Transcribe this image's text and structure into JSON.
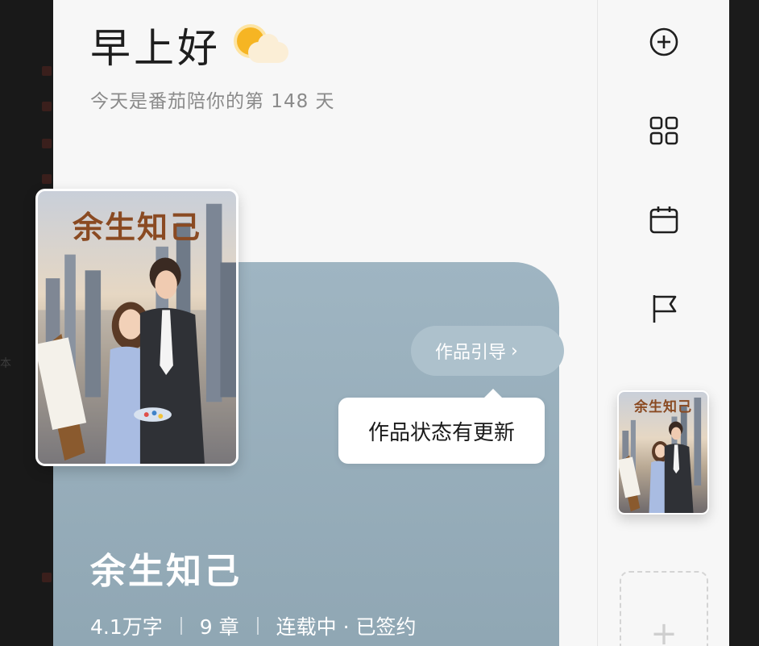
{
  "background_strip": {
    "char": "本"
  },
  "header": {
    "greeting": "早上好",
    "weather_icon": "sun-cloud-icon",
    "subtitle": "今天是番茄陪你的第 148 天"
  },
  "book": {
    "cover_title": "余生知己",
    "title": "余生知己",
    "word_count": "4.1万字",
    "chapters": "9 章",
    "status": "连载中 · 已签约",
    "guide_label": "作品引导",
    "guide_icon": "chevron-right-icon",
    "tooltip": "作品状态有更新"
  },
  "sidebar": {
    "icons": [
      "add-circle-icon",
      "grid-icon",
      "calendar-icon",
      "flag-icon"
    ],
    "selected_book_title": "余生知己",
    "add_slot_icon": "plus-icon"
  },
  "colors": {
    "card_blue": "#9fb5c2",
    "cover_title": "#8a4a22",
    "sun": "#f6b523"
  }
}
